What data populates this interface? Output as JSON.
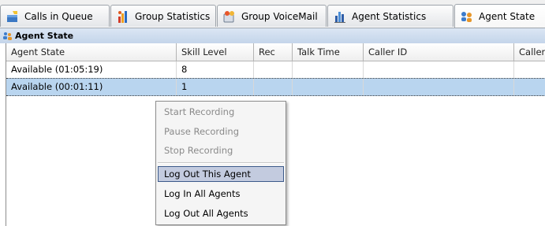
{
  "tabs": [
    {
      "label": "Calls in Queue",
      "icon": "phone-queue-icon"
    },
    {
      "label": "Group Statistics",
      "icon": "group-chart-icon"
    },
    {
      "label": "Group VoiceMail",
      "icon": "voicemail-icon"
    },
    {
      "label": "Agent Statistics",
      "icon": "agent-chart-icon"
    },
    {
      "label": "Agent State",
      "icon": "agent-state-icon",
      "active": true
    }
  ],
  "panel": {
    "title": "Agent State"
  },
  "grid": {
    "columns": [
      "Agent State",
      "Skill Level",
      "Rec",
      "Talk Time",
      "Caller ID",
      "Caller"
    ],
    "rows": [
      {
        "agent_state": "Available (01:05:19)",
        "skill_level": "8",
        "rec": "",
        "talk_time": "",
        "caller_id": "",
        "caller": ""
      },
      {
        "agent_state": "Available (00:01:11)",
        "skill_level": "1",
        "rec": "",
        "talk_time": "",
        "caller_id": "",
        "caller": "",
        "selected": true
      }
    ]
  },
  "context_menu": {
    "items": [
      {
        "label": "Start Recording",
        "enabled": false
      },
      {
        "label": "Pause Recording",
        "enabled": false
      },
      {
        "label": "Stop Recording",
        "enabled": false
      },
      {
        "label": "Log Out This Agent",
        "enabled": true,
        "highlighted": true
      },
      {
        "label": "Log In All Agents",
        "enabled": true
      },
      {
        "label": "Log Out All Agents",
        "enabled": true
      }
    ]
  },
  "colors": {
    "selection": "#b9d5ef",
    "header_gradient": "#c4d5ea",
    "menu_highlight": "#c3cbdf"
  }
}
